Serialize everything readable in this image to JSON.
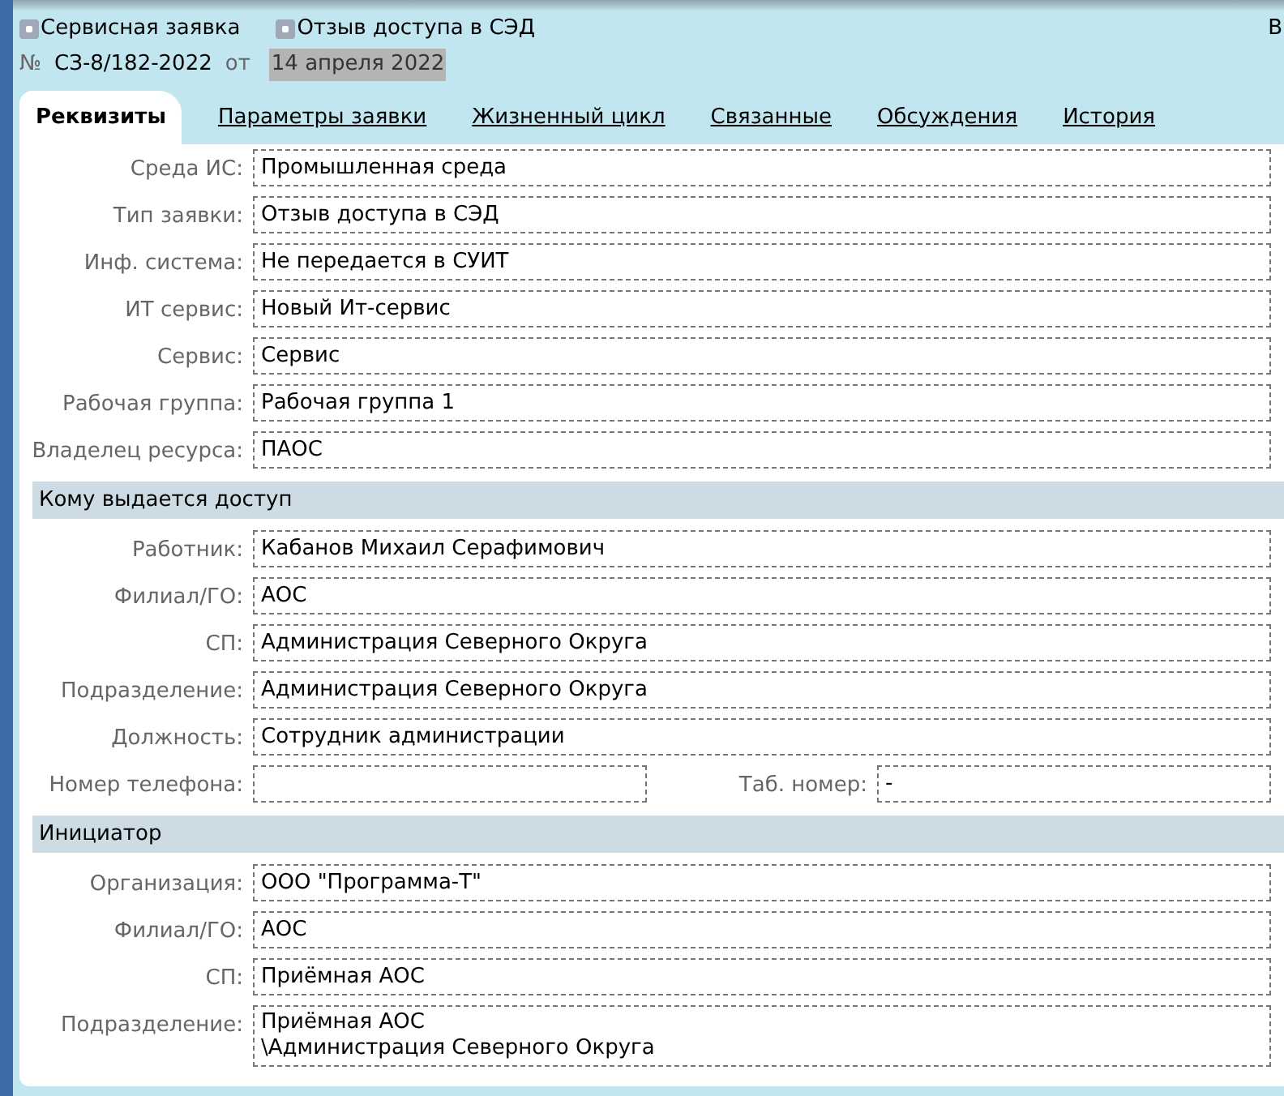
{
  "header": {
    "types": [
      "Сервисная заявка",
      "Отзыв доступа в СЭД"
    ],
    "corner_text": "В",
    "number_sign": "№",
    "number": "СЗ-8/182-2022",
    "date_prefix": "от",
    "date": "14 апреля 2022"
  },
  "tabs": [
    {
      "label": "Реквизиты",
      "selected": true
    },
    {
      "label": "Параметры заявки",
      "selected": false
    },
    {
      "label": "Жизненный цикл",
      "selected": false
    },
    {
      "label": "Связанные",
      "selected": false
    },
    {
      "label": "Обсуждения",
      "selected": false
    },
    {
      "label": "История",
      "selected": false
    }
  ],
  "sections": [
    {
      "fields": [
        {
          "kind": "single",
          "label": "Среда ИС:",
          "value": "Промышленная среда"
        },
        {
          "kind": "single",
          "label": "Тип заявки:",
          "value": "Отзыв доступа в СЭД"
        },
        {
          "kind": "single",
          "label": "Инф. система:",
          "value": "Не передается в СУИТ"
        },
        {
          "kind": "single",
          "label": "ИТ сервис:",
          "value": "Новый Ит-сервис"
        },
        {
          "kind": "single",
          "label": "Сервис:",
          "value": "Сервис"
        },
        {
          "kind": "single",
          "label": "Рабочая группа:",
          "value": "Рабочая группа 1"
        },
        {
          "kind": "single",
          "label": "Владелец ресурса:",
          "value": "ПАОС"
        }
      ]
    },
    {
      "title": "Кому выдается доступ",
      "fields": [
        {
          "kind": "single",
          "label": "Работник:",
          "value": "Кабанов Михаил Серафимович"
        },
        {
          "kind": "single",
          "label": "Филиал/ГО:",
          "value": "АОС"
        },
        {
          "kind": "single",
          "label": "СП:",
          "value": "Администрация Северного Округа"
        },
        {
          "kind": "single",
          "label": "Подразделение:",
          "value": "Администрация Северного Округа"
        },
        {
          "kind": "single",
          "label": "Должность:",
          "value": "Сотрудник администрации"
        },
        {
          "kind": "pair",
          "label": "Номер телефона:",
          "label_2": "Таб. номер:",
          "value_2": "-"
        }
      ]
    },
    {
      "title": "Инициатор",
      "fields": [
        {
          "kind": "single",
          "label": "Организация:",
          "value": "ООО \"Программа-Т\""
        },
        {
          "kind": "single",
          "label": "Филиал/ГО:",
          "value": "АОС"
        },
        {
          "kind": "single",
          "label": "СП:",
          "value": "Приёмная АОС"
        },
        {
          "kind": "multi",
          "label": "Подразделение:",
          "lines": [
            "Приёмная АОС",
            "\\Администрация Северного Округа"
          ]
        }
      ]
    }
  ]
}
